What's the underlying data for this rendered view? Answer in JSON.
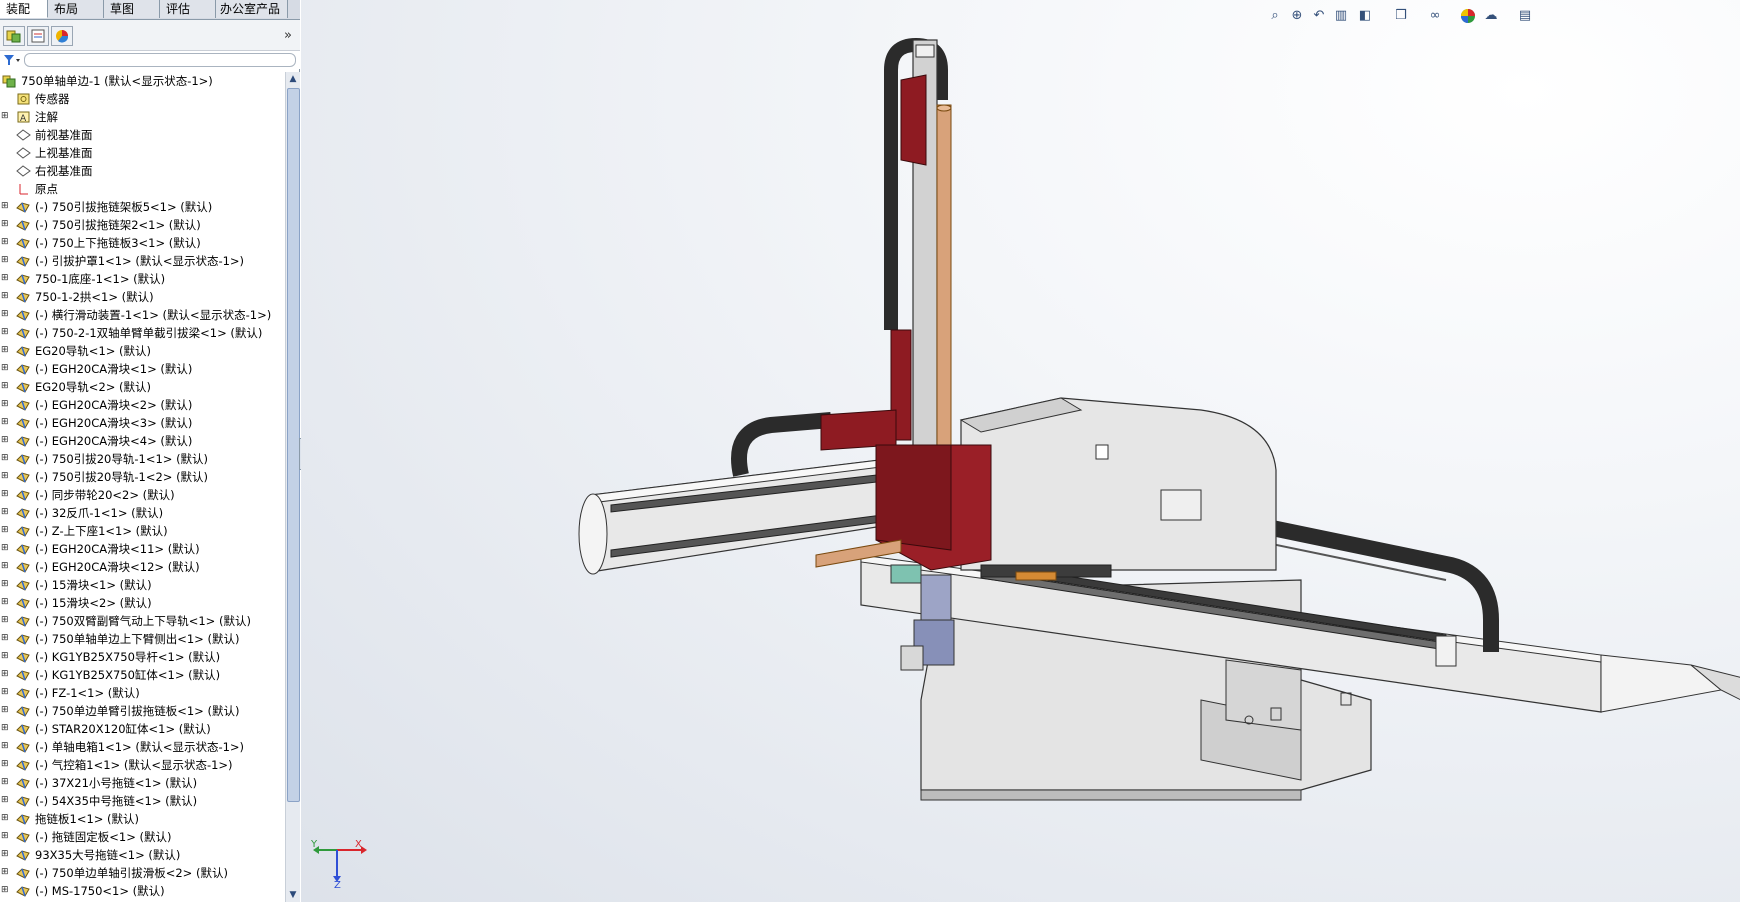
{
  "tabs": [
    "装配体",
    "布局",
    "草图",
    "评估",
    "办公室产品"
  ],
  "panel_toolbar": {
    "more_label": "»"
  },
  "tree": {
    "root": "750单轴单边-1  (默认<显示状态-1>)",
    "items": [
      "传感器",
      "注解",
      "前视基准面",
      "上视基准面",
      "右视基准面",
      "原点",
      "(-) 750引拔拖链架板5<1> (默认)",
      "(-) 750引拔拖链架2<1> (默认)",
      "(-) 750上下拖链板3<1> (默认)",
      "(-) 引拔护罩1<1> (默认<显示状态-1>)",
      "750-1底座-1<1> (默认)",
      "750-1-2拱<1> (默认)",
      "(-) 横行滑动装置-1<1> (默认<显示状态-1>)",
      "(-) 750-2-1双轴单臂单截引拔梁<1> (默认)",
      "EG20导轨<1> (默认)",
      "(-) EGH20CA滑块<1> (默认)",
      "EG20导轨<2> (默认)",
      "(-) EGH20CA滑块<2> (默认)",
      "(-) EGH20CA滑块<3> (默认)",
      "(-) EGH20CA滑块<4> (默认)",
      "(-) 750引拔20导轨-1<1> (默认)",
      "(-) 750引拔20导轨-1<2> (默认)",
      "(-) 同步带轮20<2> (默认)",
      "(-) 32反爪-1<1> (默认)",
      "(-) Z-上下座1<1> (默认)",
      "(-) EGH20CA滑块<11> (默认)",
      "(-) EGH20CA滑块<12> (默认)",
      "(-) 15滑块<1> (默认)",
      "(-) 15滑块<2> (默认)",
      "(-) 750双臂副臂气动上下导轨<1> (默认)",
      "(-) 750单轴单边上下臂侧出<1> (默认)",
      "(-) KG1YB25X750导杆<1> (默认)",
      "(-) KG1YB25X750缸体<1> (默认)",
      "(-) FZ-1<1> (默认)",
      "(-) 750单边单臂引拔拖链板<1> (默认)",
      "(-) STAR20X120缸体<1> (默认)",
      "(-) 单轴电箱1<1> (默认<显示状态-1>)",
      "(-) 气控箱1<1> (默认<显示状态-1>)",
      "(-) 37X21小号拖链<1> (默认)",
      "(-) 54X35中号拖链<1> (默认)",
      "拖链板1<1> (默认)",
      "(-) 拖链固定板<1> (默认)",
      "93X35大号拖链<1> (默认)",
      "(-) 750单边单轴引拔滑板<2> (默认)",
      "(-) MS-1750<1> (默认)"
    ]
  },
  "viewport": {
    "triad_x": "X",
    "triad_y": "Y",
    "triad_z": "Z",
    "heads_up_tools": [
      "zoom-to-fit",
      "zoom-area",
      "previous-view",
      "section-view",
      "view-orientation",
      "display-style",
      "hide-show",
      "edit-appearance",
      "apply-scene",
      "view-settings"
    ]
  },
  "colors": {
    "accent_red": "#8e1b22",
    "cable_chain": "#2b2b2b",
    "body_gray": "#d9d9d9",
    "rod_copper": "#d8a27a"
  }
}
